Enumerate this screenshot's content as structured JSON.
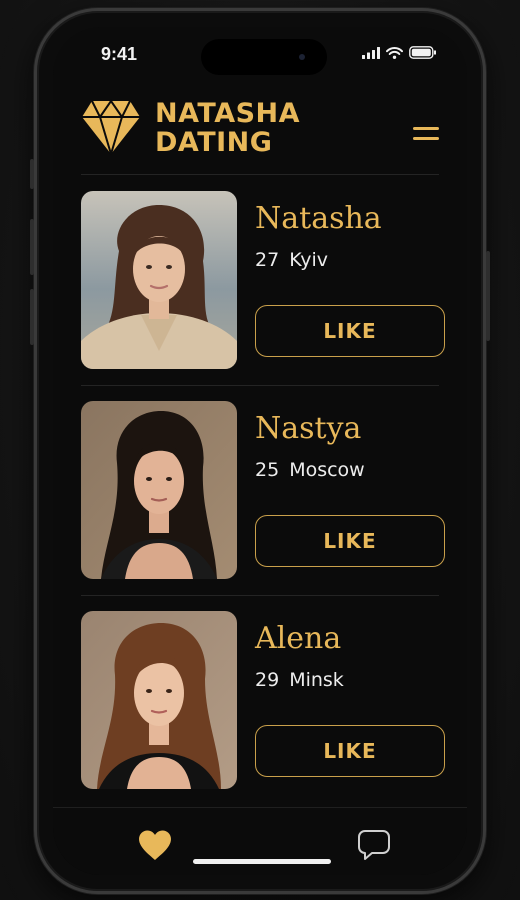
{
  "status_bar": {
    "time": "9:41",
    "icons": [
      "cellular-signal-icon",
      "wifi-icon",
      "battery-icon"
    ]
  },
  "header": {
    "brand_line1": "NATASHA",
    "brand_line2": "DATING",
    "logo_icon": "diamond-icon",
    "menu_icon": "menu-icon"
  },
  "profiles": [
    {
      "name": "Natasha",
      "age": "27",
      "city": "Kyiv",
      "like_label": "LIKE"
    },
    {
      "name": "Nastya",
      "age": "25",
      "city": "Moscow",
      "like_label": "LIKE"
    },
    {
      "name": "Alena",
      "age": "29",
      "city": "Minsk",
      "like_label": "LIKE"
    }
  ],
  "bottom_nav": {
    "items": [
      {
        "icon": "heart-icon",
        "active": true
      },
      {
        "icon": "chat-bubble-icon",
        "active": false
      }
    ]
  },
  "colors": {
    "accent": "#e8b85a",
    "background": "#0b0b0b",
    "text": "#ededed"
  }
}
